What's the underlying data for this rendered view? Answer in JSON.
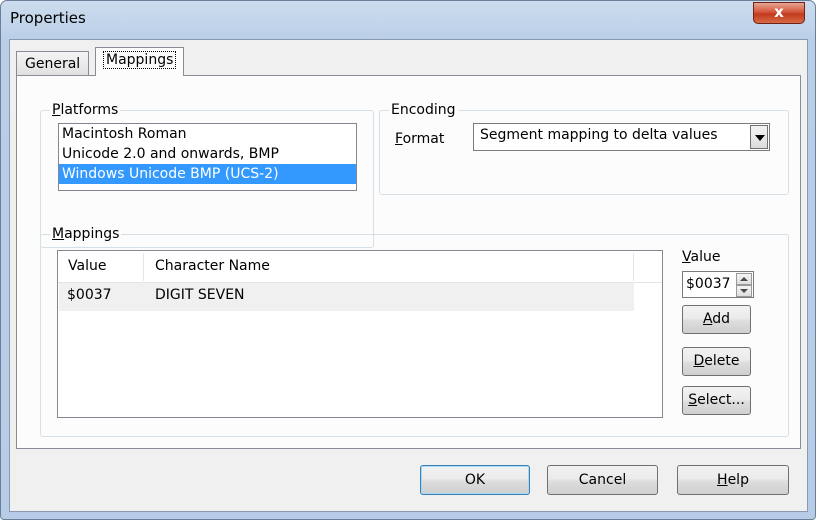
{
  "window": {
    "title": "Properties",
    "close_label": "x"
  },
  "tabs": [
    {
      "label": "General",
      "selected": false
    },
    {
      "label": "Mappings",
      "selected": true
    }
  ],
  "platforms": {
    "label": "Platforms",
    "items": [
      {
        "label": "Macintosh Roman",
        "selected": false
      },
      {
        "label": "Unicode 2.0 and onwards, BMP",
        "selected": false
      },
      {
        "label": "Windows Unicode BMP (UCS-2)",
        "selected": true
      }
    ]
  },
  "encoding": {
    "label": "Encoding",
    "format_label": "Format",
    "format_value": "Segment mapping to delta values"
  },
  "mappings": {
    "label": "Mappings",
    "columns": [
      "Value",
      "Character Name"
    ],
    "rows": [
      {
        "value": "$0037",
        "name": "DIGIT SEVEN"
      }
    ],
    "value_label": "Value",
    "value_input": "$0037",
    "add_label": "Add",
    "delete_label": "Delete",
    "select_label": "Select..."
  },
  "footer": {
    "ok_label": "OK",
    "cancel_label": "Cancel",
    "help_label": "Help"
  },
  "colors": {
    "selection": "#3399ff",
    "title_bar": "#b9cfe8",
    "close_button": "#c23a1d"
  }
}
